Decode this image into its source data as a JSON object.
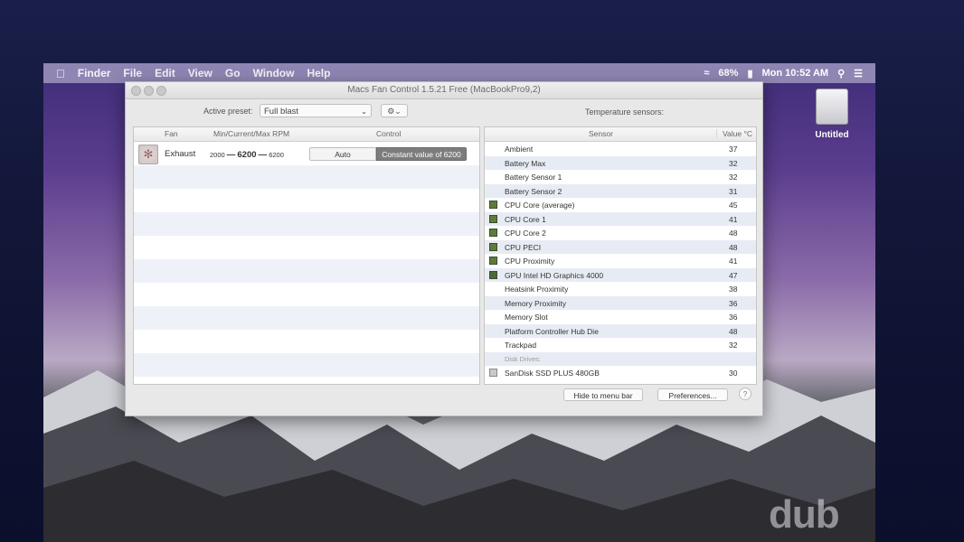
{
  "menubar": {
    "items": [
      "Finder",
      "File",
      "Edit",
      "View",
      "Go",
      "Window",
      "Help"
    ],
    "battery": "68%",
    "clock": "Mon 10:52 AM"
  },
  "desktop": {
    "drive_label": "Untitled"
  },
  "window": {
    "title": "Macs Fan Control 1.5.21 Free (MacBookPro9,2)",
    "active_preset_label": "Active preset:",
    "preset_value": "Full blast",
    "temp_sensors_label": "Temperature sensors:"
  },
  "fans": {
    "headers": {
      "fan": "Fan",
      "rpm": "Min/Current/Max RPM",
      "control": "Control"
    },
    "rows": [
      {
        "name": "Exhaust",
        "min": "2000",
        "sep": "—",
        "current": "6200",
        "max": "6200",
        "auto_label": "Auto",
        "constant_label": "Constant value of 6200"
      }
    ]
  },
  "sensors": {
    "headers": {
      "sensor": "Sensor",
      "value": "Value °C"
    },
    "rows": [
      {
        "name": "Ambient",
        "value": "37",
        "icon": ""
      },
      {
        "name": "Battery Max",
        "value": "32",
        "icon": ""
      },
      {
        "name": "Battery Sensor 1",
        "value": "32",
        "icon": ""
      },
      {
        "name": "Battery Sensor 2",
        "value": "31",
        "icon": ""
      },
      {
        "name": "CPU Core (average)",
        "value": "45",
        "icon": "cpu"
      },
      {
        "name": "CPU Core 1",
        "value": "41",
        "icon": "cpu"
      },
      {
        "name": "CPU Core 2",
        "value": "48",
        "icon": "cpu"
      },
      {
        "name": "CPU PECI",
        "value": "48",
        "icon": "cpu"
      },
      {
        "name": "CPU Proximity",
        "value": "41",
        "icon": "cpu"
      },
      {
        "name": "GPU Intel HD Graphics 4000",
        "value": "47",
        "icon": "gpu"
      },
      {
        "name": "Heatsink Proximity",
        "value": "38",
        "icon": ""
      },
      {
        "name": "Memory Proximity",
        "value": "36",
        "icon": ""
      },
      {
        "name": "Memory Slot",
        "value": "36",
        "icon": ""
      },
      {
        "name": "Platform Controller Hub Die",
        "value": "48",
        "icon": ""
      },
      {
        "name": "Trackpad",
        "value": "32",
        "icon": ""
      },
      {
        "name": "Disk Drives:",
        "value": "",
        "icon": "",
        "group": true
      },
      {
        "name": "SanDisk SSD PLUS 480GB",
        "value": "30",
        "icon": "disk"
      }
    ]
  },
  "footer": {
    "hide_label": "Hide to menu bar",
    "preferences_label": "Preferences...",
    "help_label": "?"
  }
}
